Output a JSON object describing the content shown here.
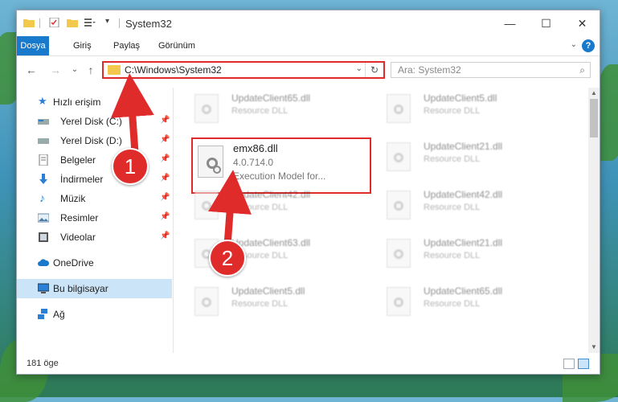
{
  "window": {
    "title": "System32",
    "controls": {
      "minimize": "—",
      "maximize": "☐",
      "close": "✕"
    }
  },
  "ribbon": {
    "tabs": [
      {
        "label": "Dosya",
        "active": true
      },
      {
        "label": "Giriş"
      },
      {
        "label": "Paylaş"
      },
      {
        "label": "Görünüm"
      }
    ],
    "help": "?"
  },
  "nav": {
    "address": "C:\\Windows\\System32",
    "search_placeholder": "Ara: System32"
  },
  "sidebar": {
    "items": [
      {
        "label": "Hızlı erişim",
        "icon": "star-icon"
      },
      {
        "label": "Yerel Disk (C:)",
        "icon": "drive-icon",
        "pinned": true
      },
      {
        "label": "Yerel Disk (D:)",
        "icon": "drive-icon",
        "pinned": true
      },
      {
        "label": "Belgeler",
        "icon": "document-icon",
        "pinned": true
      },
      {
        "label": "İndirmeler",
        "icon": "download-icon",
        "pinned": true
      },
      {
        "label": "Müzik",
        "icon": "music-icon",
        "pinned": true
      },
      {
        "label": "Resimler",
        "icon": "pictures-icon",
        "pinned": true
      },
      {
        "label": "Videolar",
        "icon": "video-icon",
        "pinned": true
      },
      {
        "label": "OneDrive",
        "icon": "cloud-icon"
      },
      {
        "label": "Bu bilgisayar",
        "icon": "computer-icon",
        "selected": true
      },
      {
        "label": "Ağ",
        "icon": "network-icon"
      }
    ]
  },
  "files": {
    "left_column": [
      {
        "name": "UpdateClient65.dll",
        "type": "Resource DLL"
      },
      {
        "name": "UpdateClient42.dll",
        "type": "Resource DLL"
      },
      {
        "name": "UpdateClient63.dll",
        "type": "Resource DLL"
      },
      {
        "name": "UpdateClient5.dll",
        "type": "Resource DLL"
      }
    ],
    "right_column": [
      {
        "name": "UpdateClient5.dll",
        "type": "Resource DLL"
      },
      {
        "name": "UpdateClient21.dll",
        "type": "Resource DLL"
      },
      {
        "name": "UpdateClient42.dll",
        "type": "Resource DLL"
      },
      {
        "name": "UpdateClient21.dll",
        "type": "Resource DLL"
      },
      {
        "name": "UpdateClient65.dll",
        "type": "Resource DLL"
      }
    ],
    "highlighted": {
      "name": "emx86.dll",
      "version": "4.0.714.0",
      "description": "Execution Model for..."
    }
  },
  "status": {
    "count": "181 öge"
  },
  "callouts": [
    {
      "number": "1"
    },
    {
      "number": "2"
    }
  ],
  "colors": {
    "accent": "#1979ca",
    "highlight": "#e02b2b",
    "selection": "#cce4f7"
  }
}
